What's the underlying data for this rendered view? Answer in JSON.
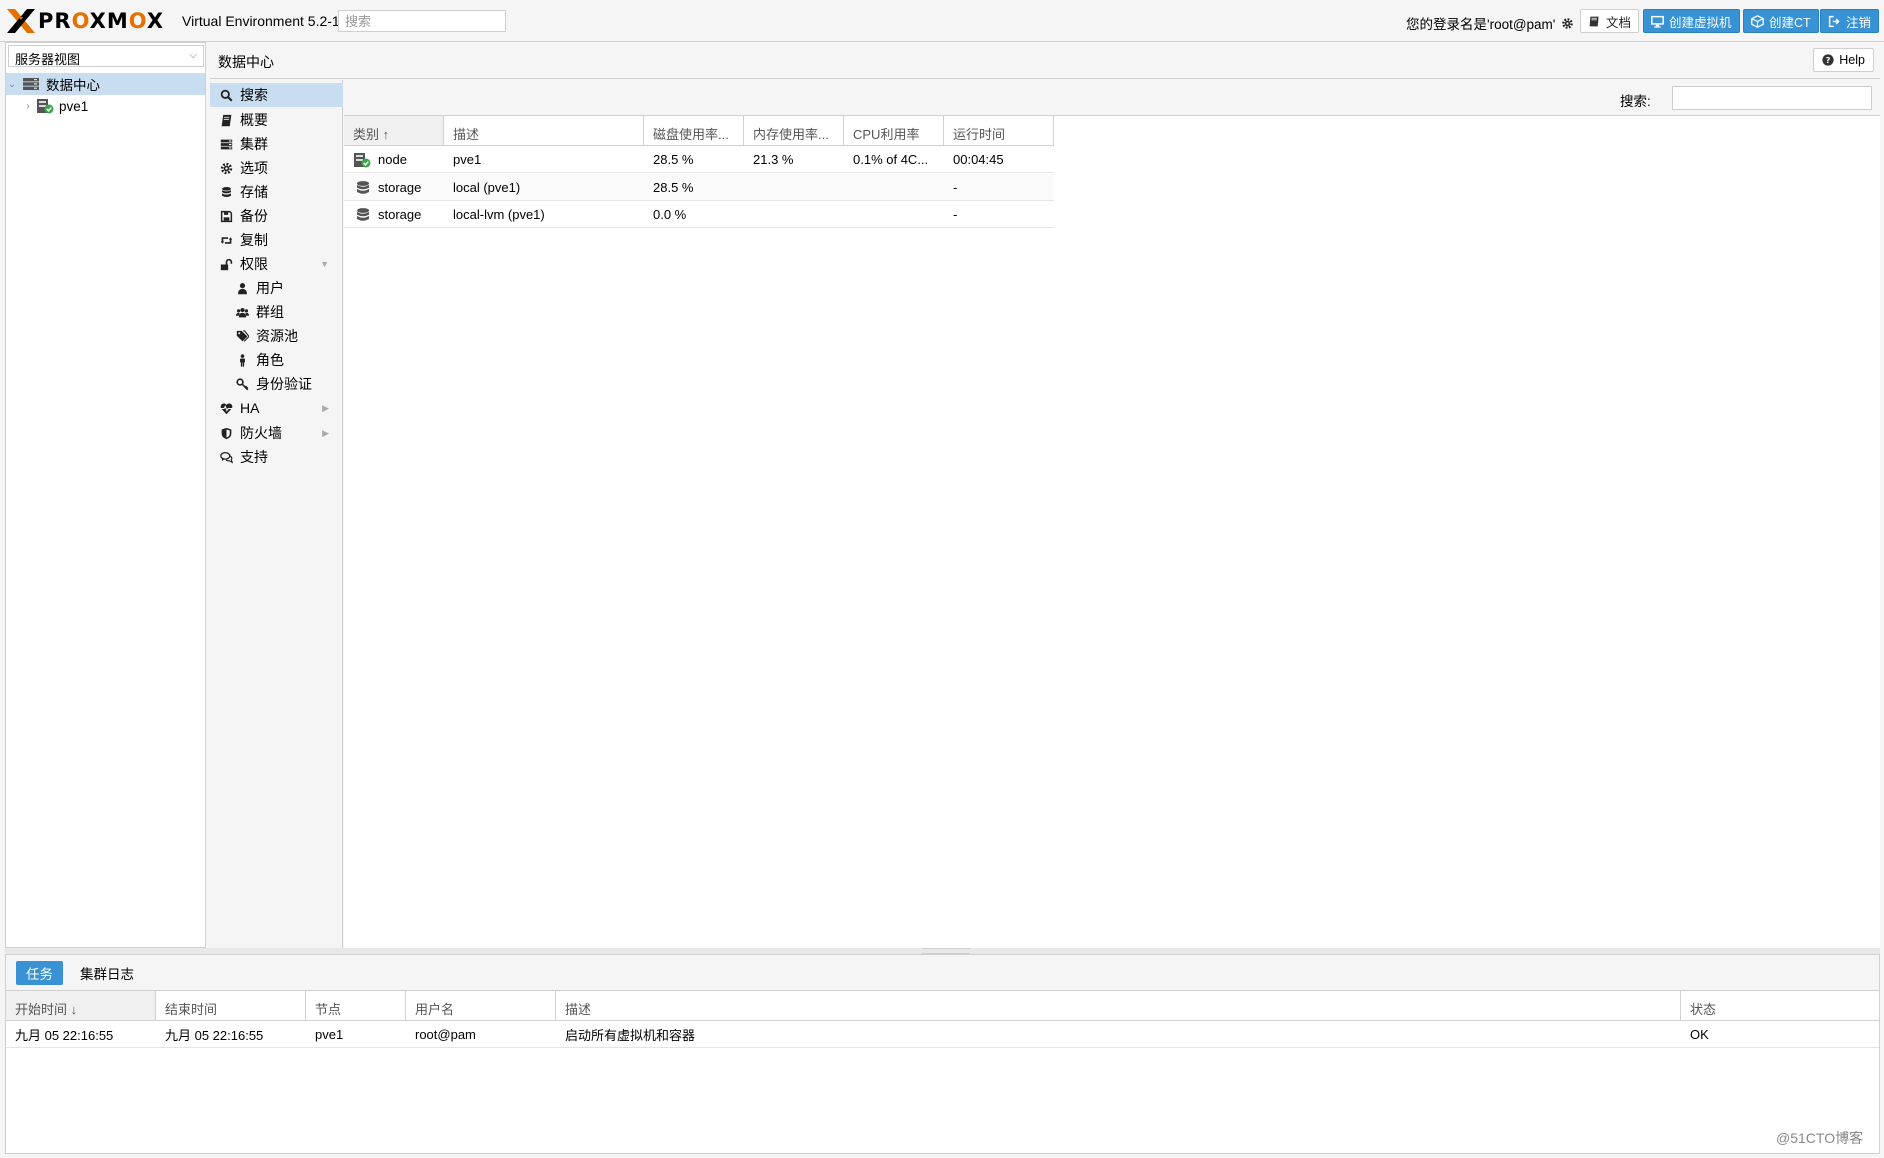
{
  "topbar": {
    "logo_text_a": "PR",
    "logo_text_o1": "O",
    "logo_text_b": "XM",
    "logo_text_o2": "O",
    "logo_text_c": "X",
    "version": "Virtual Environment 5.2-1",
    "search_placeholder": "搜索",
    "login_info": "您的登录名是'root@pam'",
    "docs_label": "文档",
    "create_vm_label": "创建虚拟机",
    "create_ct_label": "创建CT",
    "logout_label": "注销"
  },
  "tree": {
    "view_select": "服务器视图",
    "items": [
      {
        "label": "数据中心",
        "icon": "datacenter-icon"
      },
      {
        "label": "pve1",
        "icon": "node-online-icon"
      }
    ]
  },
  "content_header": {
    "title": "数据中心",
    "help_label": "Help"
  },
  "nav": {
    "items": [
      {
        "label": "搜索",
        "icon": "search-icon"
      },
      {
        "label": "概要",
        "icon": "book-icon"
      },
      {
        "label": "集群",
        "icon": "server-icon"
      },
      {
        "label": "选项",
        "icon": "gear-icon"
      },
      {
        "label": "存储",
        "icon": "database-icon"
      },
      {
        "label": "备份",
        "icon": "floppy-icon"
      },
      {
        "label": "复制",
        "icon": "retweet-icon"
      },
      {
        "label": "权限",
        "icon": "unlock-icon"
      },
      {
        "label": "用户",
        "icon": "user-icon"
      },
      {
        "label": "群组",
        "icon": "users-icon"
      },
      {
        "label": "资源池",
        "icon": "tags-icon"
      },
      {
        "label": "角色",
        "icon": "male-icon"
      },
      {
        "label": "身份验证",
        "icon": "key-icon"
      },
      {
        "label": "HA",
        "icon": "heartbeat-icon"
      },
      {
        "label": "防火墙",
        "icon": "shield-icon"
      },
      {
        "label": "支持",
        "icon": "comments-icon"
      }
    ]
  },
  "search_panel": {
    "search_label": "搜索:",
    "columns": [
      "类别 ↑",
      "描述",
      "磁盘使用率...",
      "内存使用率...",
      "CPU利用率",
      "运行时间"
    ],
    "rows": [
      {
        "type": "node",
        "desc": "pve1",
        "disk": "28.5 %",
        "mem": "21.3 %",
        "cpu": "0.1% of 4C...",
        "uptime": "00:04:45"
      },
      {
        "type": "storage",
        "desc": "local (pve1)",
        "disk": "28.5 %",
        "mem": "",
        "cpu": "",
        "uptime": "-"
      },
      {
        "type": "storage",
        "desc": "local-lvm (pve1)",
        "disk": "0.0 %",
        "mem": "",
        "cpu": "",
        "uptime": "-"
      }
    ]
  },
  "log_panel": {
    "tabs": [
      "任务",
      "集群日志"
    ],
    "columns": [
      "开始时间 ↓",
      "结束时间",
      "节点",
      "用户名",
      "描述",
      "状态"
    ],
    "rows": [
      {
        "start": "九月 05 22:16:55",
        "end": "九月 05 22:16:55",
        "node": "pve1",
        "user": "root@pam",
        "desc": "启动所有虚拟机和容器",
        "status": "OK"
      }
    ]
  },
  "watermark": "@51CTO博客",
  "colors": {
    "accent": "#3892d4",
    "selection": "#c8ddf0",
    "brand_orange": "#e57000",
    "status_green": "#3aa64b"
  }
}
